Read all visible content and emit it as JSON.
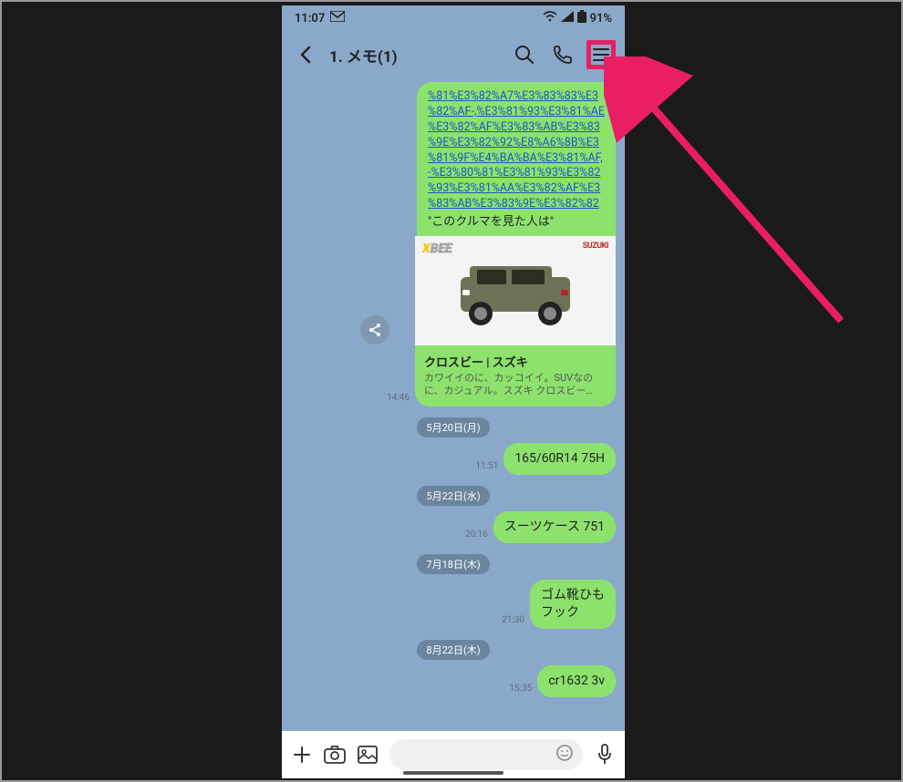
{
  "statusbar": {
    "time": "11:07",
    "battery": "91%"
  },
  "header": {
    "title": "1. メモ(1)"
  },
  "messages": {
    "url_bubble": {
      "lines": [
        "%81%E3%82%A7%E3%83%83%E3",
        "%82%AF-,%E3%81%93%E3%81%AE",
        "%E3%82%AF%E3%83%AB%E3%83",
        "%9E%E3%82%92%E8%A6%8B%E3",
        "%81%9F%E4%BA%BA%E3%81%AF,",
        "-%E3%80%81%E3%81%93%E3%82",
        "%93%E3%81%AA%E3%82%AF%E3",
        "%83%AB%E3%83%9E%E3%82%82"
      ],
      "caption": "\"このクルマを見た人は\""
    },
    "card": {
      "brand": "SUZUKI",
      "title": "クロスビー | スズキ",
      "desc": "カワイイのに、カッコイイ。SUVなのに、カジュアル。スズキ クロスビー…",
      "time": "14:46"
    },
    "sep1": "5月20日(月)",
    "m1": {
      "text": "165/60R14 75H",
      "time": "11:51"
    },
    "sep2": "5月22日(水)",
    "m2": {
      "text": "スーツケース 751",
      "time": "20:16"
    },
    "sep3": "7月18日(木)",
    "m3": {
      "text": "ゴム靴ひも\nフック",
      "time": "21:30"
    },
    "sep4": "8月22日(木)",
    "m4": {
      "text": "cr1632 3v",
      "time": "15:35"
    }
  }
}
